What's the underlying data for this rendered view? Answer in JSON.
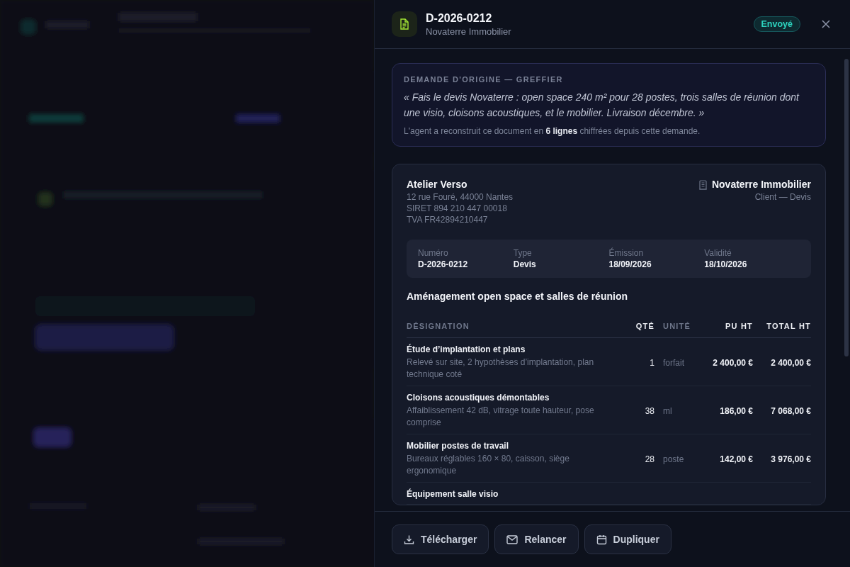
{
  "panel": {
    "title": "D-2026-0212",
    "subtitle": "Novaterre Immobilier",
    "status": {
      "label": "Envoyé",
      "kind": "sent"
    }
  },
  "request": {
    "heading": "DEMANDE D'ORIGINE — GREFFIER",
    "quote": "« Fais le devis Novaterre : open space 240 m² pour 28 postes, trois salles de réunion dont une visio, cloisons acoustiques, et le mobilier. Livraison décembre. »",
    "note": "L'agent a reconstruit ce document en **6 lignes** chiffrées depuis cette demande."
  },
  "document": {
    "issuer": {
      "name": "Atelier Verso",
      "lines": [
        "12 rue Fouré, 44000 Nantes",
        "SIRET 894 210 447 00018",
        "TVA FR42894210447"
      ]
    },
    "client": {
      "name": "Novaterre Immobilier",
      "role": "Client — Devis"
    },
    "meta": [
      {
        "label": "Numéro",
        "value": "D-2026-0212"
      },
      {
        "label": "Type",
        "value": "Devis"
      },
      {
        "label": "Émission",
        "value": "18/09/2026"
      },
      {
        "label": "Validité",
        "value": "18/10/2026"
      }
    ],
    "subject": "Aménagement open space et salles de réunion",
    "columns": [
      "DÉSIGNATION",
      "QTÉ",
      "UNITÉ",
      "PU HT",
      "TOTAL HT"
    ],
    "rows": [
      {
        "name": "Étude d’implantation et plans",
        "description": "Relevé sur site, 2 hypothèses d’implantation, plan technique coté",
        "qty": "1",
        "unit": "forfait",
        "unit_price": "2 400,00 €",
        "total": "2 400,00 €"
      },
      {
        "name": "Cloisons acoustiques démontables",
        "description": "Affaiblissement 42 dB, vitrage toute hauteur, pose comprise",
        "qty": "38",
        "unit": "ml",
        "unit_price": "186,00 €",
        "total": "7 068,00 €"
      },
      {
        "name": "Mobilier postes de travail",
        "description": "Bureaux réglables 160 × 80, caisson, siège ergonomique",
        "qty": "28",
        "unit": "poste",
        "unit_price": "142,00 €",
        "total": "3 976,00 €"
      },
      {
        "name": "Équipement salle visio"
      }
    ]
  },
  "actions": [
    {
      "label": "Télécharger",
      "kind": "download"
    },
    {
      "label": "Relancer",
      "kind": "mail"
    },
    {
      "label": "Dupliquer",
      "kind": "calendar"
    }
  ]
}
